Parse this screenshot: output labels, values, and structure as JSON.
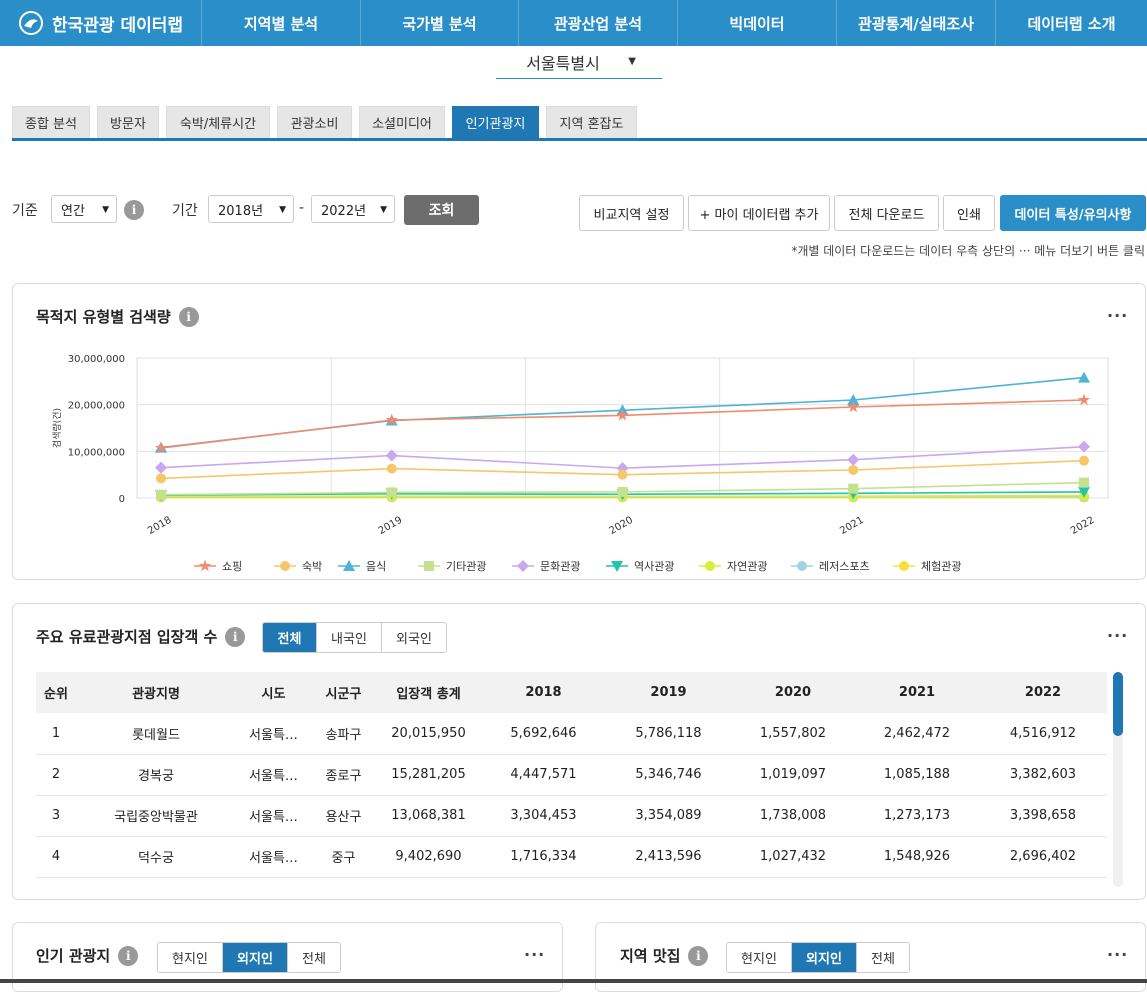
{
  "nav": {
    "brand": "한국관광 데이터랩",
    "items": [
      "지역별 분석",
      "국가별 분석",
      "관광산업 분석",
      "빅데이터",
      "관광통계/실태조사",
      "데이터랩 소개"
    ]
  },
  "region": {
    "selected": "서울특별시"
  },
  "tabs": [
    "종합 분석",
    "방문자",
    "숙박/체류시간",
    "관광소비",
    "소셜미디어",
    "인기관광지",
    "지역 혼잡도"
  ],
  "active_tab": "인기관광지",
  "filters": {
    "basis_label": "기준",
    "basis_value": "연간",
    "period_label": "기간",
    "from": "2018년",
    "dash": "-",
    "to": "2022년",
    "search_button": "조회"
  },
  "actions": {
    "compare": "비교지역 설정",
    "add_mydata": "+ 마이 데이터랩 추가",
    "download_all": "전체 다운로드",
    "print": "인쇄",
    "notes": "데이터 특성/유의사항"
  },
  "note": "*개별 데이터 다운로드는 데이터 우측 상단의 ··· 메뉴 더보기 버튼 클릭",
  "search_card": {
    "title": "목적지 유형별 검색량",
    "more": "···"
  },
  "chart_data": {
    "type": "line",
    "title": "목적지 유형별 검색량",
    "ylabel": "검색량(건)",
    "xlabel": "",
    "x": [
      "2018",
      "2019",
      "2020",
      "2021",
      "2022"
    ],
    "ylim": [
      0,
      30000000
    ],
    "yticks": [
      "30,000,000",
      "20,000,000",
      "10,000,000",
      "0"
    ],
    "grid": true,
    "legend": "bottom",
    "series": [
      {
        "name": "쇼핑",
        "color": "#f08c6e",
        "marker": "star",
        "values": [
          10700000,
          16700000,
          17700000,
          19500000,
          21000000
        ]
      },
      {
        "name": "숙박",
        "color": "#f5c76a",
        "marker": "circle",
        "values": [
          4200000,
          6300000,
          5000000,
          6000000,
          8000000
        ]
      },
      {
        "name": "음식",
        "color": "#4fb3d6",
        "marker": "triangle",
        "values": [
          10800000,
          16600000,
          18800000,
          21000000,
          25800000
        ]
      },
      {
        "name": "기타관광",
        "color": "#c5e08e",
        "marker": "square",
        "values": [
          700000,
          1200000,
          1300000,
          2000000,
          3300000
        ]
      },
      {
        "name": "문화관광",
        "color": "#c9a8ee",
        "marker": "diamond",
        "values": [
          6500000,
          9100000,
          6400000,
          8200000,
          11000000
        ]
      },
      {
        "name": "역사관광",
        "color": "#22c4b0",
        "marker": "triangle-down",
        "values": [
          600000,
          900000,
          800000,
          1000000,
          1300000
        ]
      },
      {
        "name": "자연관광",
        "color": "#d8ee3c",
        "marker": "circle",
        "values": [
          300000,
          400000,
          300000,
          400000,
          500000
        ]
      },
      {
        "name": "레저스포츠",
        "color": "#9fd3e6",
        "marker": "circle",
        "values": [
          200000,
          300000,
          200000,
          300000,
          300000
        ]
      },
      {
        "name": "체험관광",
        "color": "#f5e03a",
        "marker": "circle",
        "values": [
          100000,
          100000,
          100000,
          100000,
          100000
        ]
      }
    ]
  },
  "visitors_card": {
    "title": "주요 유료관광지점 입장객 수",
    "segments": [
      "전체",
      "내국인",
      "외국인"
    ],
    "active": "전체",
    "more": "···",
    "columns": [
      "순위",
      "관광지명",
      "시도",
      "시군구",
      "입장객 총계",
      "2018",
      "2019",
      "2020",
      "2021",
      "2022"
    ],
    "rows": [
      [
        "1",
        "롯데월드",
        "서울특…",
        "송파구",
        "20,015,950",
        "5,692,646",
        "5,786,118",
        "1,557,802",
        "2,462,472",
        "4,516,912"
      ],
      [
        "2",
        "경복궁",
        "서울특…",
        "종로구",
        "15,281,205",
        "4,447,571",
        "5,346,746",
        "1,019,097",
        "1,085,188",
        "3,382,603"
      ],
      [
        "3",
        "국립중앙박물관",
        "서울특…",
        "용산구",
        "13,068,381",
        "3,304,453",
        "3,354,089",
        "1,738,008",
        "1,273,173",
        "3,398,658"
      ],
      [
        "4",
        "덕수궁",
        "서울특…",
        "중구",
        "9,402,690",
        "1,716,334",
        "2,413,596",
        "1,027,432",
        "1,548,926",
        "2,696,402"
      ]
    ]
  },
  "popular_card": {
    "title": "인기 관광지",
    "segments": [
      "현지인",
      "외지인",
      "전체"
    ],
    "active": "외지인",
    "more": "···"
  },
  "food_card": {
    "title": "지역 맛집",
    "segments": [
      "현지인",
      "외지인",
      "전체"
    ],
    "active": "외지인",
    "more": "···"
  }
}
